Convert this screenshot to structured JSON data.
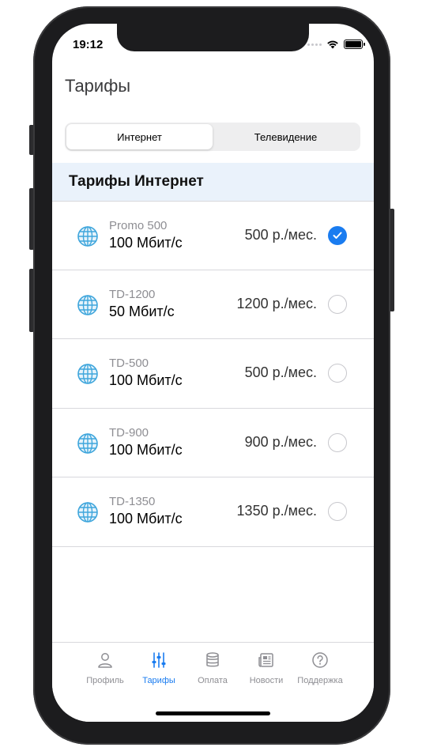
{
  "status_bar": {
    "time": "19:12"
  },
  "header": {
    "title": "Тарифы"
  },
  "segmented": {
    "segments": [
      {
        "label": "Интернет",
        "selected": true
      },
      {
        "label": "Телевидение",
        "selected": false
      }
    ]
  },
  "section": {
    "title": "Тарифы Интернет"
  },
  "tariffs": [
    {
      "name": "Promo 500",
      "speed": "100 Мбит/с",
      "price": "500 р./мес.",
      "selected": true,
      "icon": "globe-icon"
    },
    {
      "name": "TD-1200",
      "speed": "50 Мбит/с",
      "price": "1200 р./мес.",
      "selected": false,
      "icon": "globe-icon"
    },
    {
      "name": "TD-500",
      "speed": "100 Мбит/с",
      "price": "500 р./мес.",
      "selected": false,
      "icon": "globe-icon"
    },
    {
      "name": "TD-900",
      "speed": "100 Мбит/с",
      "price": "900 р./мес.",
      "selected": false,
      "icon": "globe-icon"
    },
    {
      "name": "TD-1350",
      "speed": "100 Мбит/с",
      "price": "1350 р./мес.",
      "selected": false,
      "icon": "globe-icon"
    }
  ],
  "tabbar": {
    "tabs": [
      {
        "label": "Профиль",
        "icon": "person-icon",
        "active": false
      },
      {
        "label": "Тарифы",
        "icon": "sliders-icon",
        "active": true
      },
      {
        "label": "Оплата",
        "icon": "database-icon",
        "active": false
      },
      {
        "label": "Новости",
        "icon": "newspaper-icon",
        "active": false
      },
      {
        "label": "Поддержка",
        "icon": "question-icon",
        "active": false
      }
    ]
  },
  "colors": {
    "accent": "#1a7cf0",
    "section_bg": "#eaf2fb",
    "inactive": "#8e8e93"
  }
}
